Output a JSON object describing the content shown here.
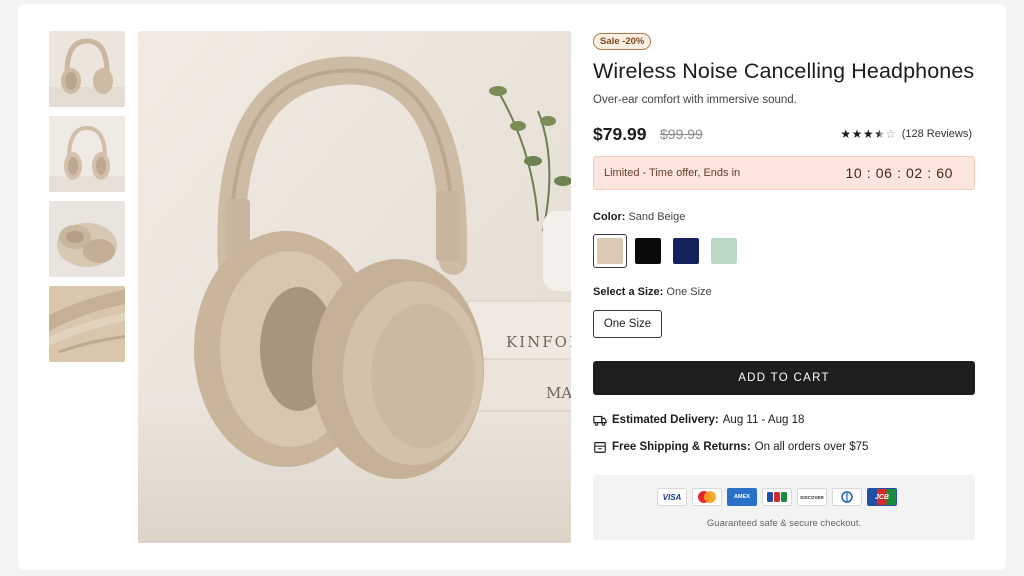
{
  "product": {
    "badge": "Sale -20%",
    "title": "Wireless Noise Cancelling Headphones",
    "subtitle": "Over-ear comfort with immersive sound.",
    "price": "$79.99",
    "old_price": "$99.99",
    "rating": {
      "value": 3.5,
      "max": 5,
      "reviews_text": "(128 Reviews)"
    }
  },
  "offer": {
    "text": "Limited - Time offer, Ends in",
    "countdown": "10 : 06 : 02 : 60"
  },
  "color": {
    "label": "Color:",
    "selected": "Sand Beige",
    "swatches": [
      {
        "name": "sand-beige",
        "hex": "#d9c9b5",
        "selected": true
      },
      {
        "name": "black",
        "hex": "#0a0a0a",
        "selected": false
      },
      {
        "name": "navy",
        "hex": "#14215a",
        "selected": false
      },
      {
        "name": "sage",
        "hex": "#bcd7c5",
        "selected": false
      }
    ]
  },
  "size": {
    "label": "Select a Size:",
    "selected": "One Size",
    "option": "One Size"
  },
  "cta": {
    "add_to_cart": "ADD TO CART"
  },
  "delivery": {
    "label": "Estimated Delivery:",
    "value": "Aug 11 - Aug 18",
    "icon": "truck-icon"
  },
  "shipping": {
    "label": "Free Shipping & Returns:",
    "value": "On all orders over $75",
    "icon": "box-icon"
  },
  "payment": {
    "cards": [
      "VISA",
      "mastercard",
      "AMEX",
      "JCB",
      "DISCOVER",
      "Diners Club",
      "JCB"
    ],
    "secure_text": "Guaranteed safe & secure checkout."
  },
  "colors": {
    "accent_badge": "#b07a4d",
    "offer_bg": "#fde6df",
    "cta_bg": "#1e1e1e"
  }
}
